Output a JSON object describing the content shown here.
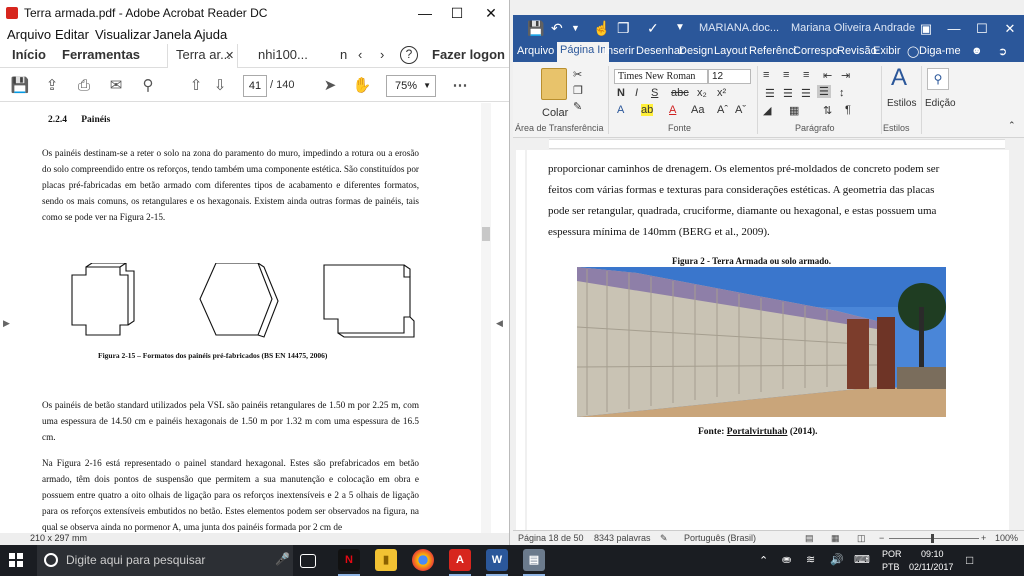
{
  "acrobat": {
    "window_title": "Terra armada.pdf - Adobe Acrobat Reader DC",
    "menu": [
      "Arquivo",
      "Editar",
      "Visualizar",
      "Janela",
      "Ajuda"
    ],
    "tabs": {
      "home": "Início",
      "tools": "Ferramentas",
      "doc1": "Terra ar...",
      "doc2": "nhi100...",
      "doc3": "n",
      "login": "Fazer logon"
    },
    "toolbar": {
      "current_page": "41",
      "total_pages": "/ 140",
      "zoom": "75%"
    },
    "page": {
      "heading_number": "2.2.4",
      "heading_title": "Painéis",
      "paragraph1": "Os painéis destinam-se a reter o solo na zona do paramento do muro, impedindo a rotura ou a erosão do solo compreendido entre os reforços, tendo também uma componente estética. São constituídos por placas pré-fabricadas em betão armado com diferentes tipos de acabamento e diferentes formatos, sendo os mais comuns, os retangulares e os hexagonais. Existem ainda outras formas de painéis, tais como se pode ver na Figura 2-15.",
      "figure_caption": "Figura 2-15 – Formatos dos painéis pré-fabricados (BS EN 14475, 2006)",
      "paragraph2": "Os painéis de betão standard utilizados pela VSL são painéis retangulares de 1.50 m por 2.25 m, com uma espessura de 14.50 cm e painéis hexagonais de 1.50 m por 1.32 m com uma espessura de 16.5 cm.",
      "paragraph3": "Na Figura 2-16 está representado o painel standard hexagonal. Estes são prefabricados em betão armado, têm dois pontos de suspensão que permitem a sua manutenção e colocação em obra e possuem entre quatro a oito olhais de ligação para os reforços inextensíveis e 2 a 5 olhais de ligação para os reforços extensíveis embutidos no betão. Estes elementos podem ser observados na figura, na qual se observa ainda no pormenor A, uma junta dos painéis formada por 2 cm de"
    },
    "status_size": "210 x 297 mm"
  },
  "word": {
    "doc_title": "MARIANA.doc...",
    "user": "Mariana Oliveira Andrade",
    "tabs": [
      "Arquivo",
      "Página In",
      "Inserir",
      "Desenhar",
      "Design",
      "Layout",
      "Referênci",
      "Correspo",
      "Revisão",
      "Exibir",
      "Diga-me"
    ],
    "ribbon": {
      "paste": "Colar",
      "font_name": "Times New Roman",
      "font_size": "12",
      "styles": "Estilos",
      "editing": "Edição",
      "group_clipboard": "Área de Transferência",
      "group_font": "Fonte",
      "group_paragraph": "Parágrafo",
      "group_styles": "Estilos"
    },
    "body_lines": [
      "proporcionar caminhos de drenagem. Os elementos pré-moldados de concreto podem ser",
      "feitos com várias formas e texturas para considerações estéticas. A geometria das placas",
      "pode ser retangular, quadrada, cruciforme, diamante ou hexagonal, e estas possuem uma",
      "espessura mínima de 140mm (BERG et al., 2009)."
    ],
    "figure_caption": "Figura 2 - Terra Armada ou solo armado.",
    "fonte_prefix": "Fonte: ",
    "fonte_link": "Portalvirtuhab",
    "fonte_suffix": " (2014).",
    "status": {
      "page": "Página 18 de 50",
      "words": "8343 palavras",
      "language": "Português (Brasil)",
      "zoom": "100%"
    }
  },
  "taskbar": {
    "search_placeholder": "Digite aqui para pesquisar",
    "lang1": "POR",
    "lang2": "PTB",
    "time": "09:10",
    "date": "02/11/2017"
  }
}
